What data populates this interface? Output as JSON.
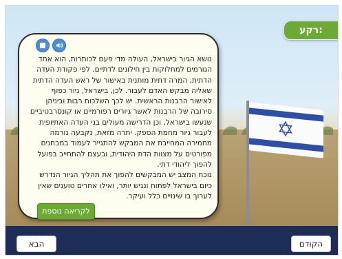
{
  "tag_label": "רקע:",
  "card": {
    "paragraph1": "נושא הגיור בישראל, העולה מדי פעם לכותרות, הוא אחד הגורמים למחלוקות בין חילונים לדתיים. לפי פקודת העדה הדתית, המרה דתית מותנית באישור של ראש העדה הדתית שאליה מבקש האדם לעבור. לכן, בישראל, גיור כפוף לאישור הרבנות הראשית. יש לכך השלכות רבות וביניהן סירובה של הרבנות לאשר גיורים רפורמיים או קונסרבטיביים שנעשו בישראל, וכן הדרישה מעולים בני העדה האתיופית לעבור גיור מחמת הספק. יתרה מזאת, נקבעה נורמה מחמירה המחייבת את המבקש להתגייר לעמוד במבחנים מפורטים על מצוות הדת היהודית, ובעצם להתחייב בפועל להפוך ליהודי דתי.",
    "paragraph2": "נוכח המצב יש המבקשים להפוך את תהליך הגיור הנדרש כיום בישראל לפתוח ונגיש יותר, ואילו אחרים טוענים שאין לערוך בו שינויים כלל ועיקר.",
    "more_label": "לקריאה נוספת"
  },
  "nav": {
    "next_label": "הבא",
    "prev_label": "הקודם"
  },
  "icons": [
    "stop-icon",
    "audio-icon"
  ],
  "colors": {
    "accent_green": "#6aaa35",
    "nav_bar": "#1d2d58",
    "icon_blue": "#4a8fd3"
  }
}
